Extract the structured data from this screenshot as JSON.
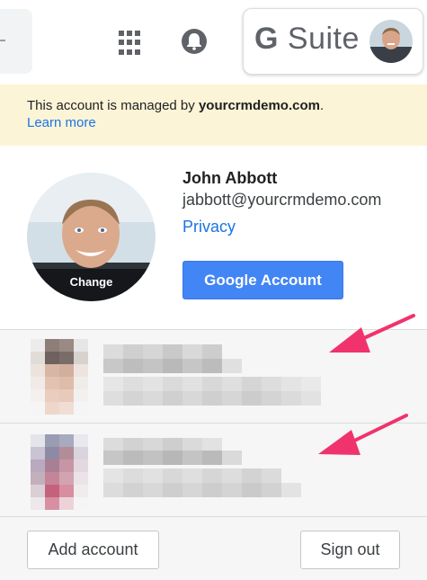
{
  "topbar": {
    "apps_icon": "apps-grid-icon",
    "notifications_icon": "bell-icon",
    "brand": {
      "letter": "G",
      "word": "Suite"
    }
  },
  "banner": {
    "text_prefix": "This account is managed by ",
    "domain": "yourcrmdemo.com",
    "text_suffix": ".",
    "learn_more": "Learn more"
  },
  "profile": {
    "change_label": "Change",
    "name": "John Abbott",
    "email": "jabbott@yourcrmdemo.com",
    "privacy": "Privacy",
    "google_account": "Google Account"
  },
  "footer": {
    "add_account": "Add account",
    "sign_out": "Sign out"
  },
  "colors": {
    "accent_blue": "#4285f4",
    "link_blue": "#1a73e8",
    "banner_bg": "#fcf4d6",
    "arrow_pink": "#f0336c"
  }
}
